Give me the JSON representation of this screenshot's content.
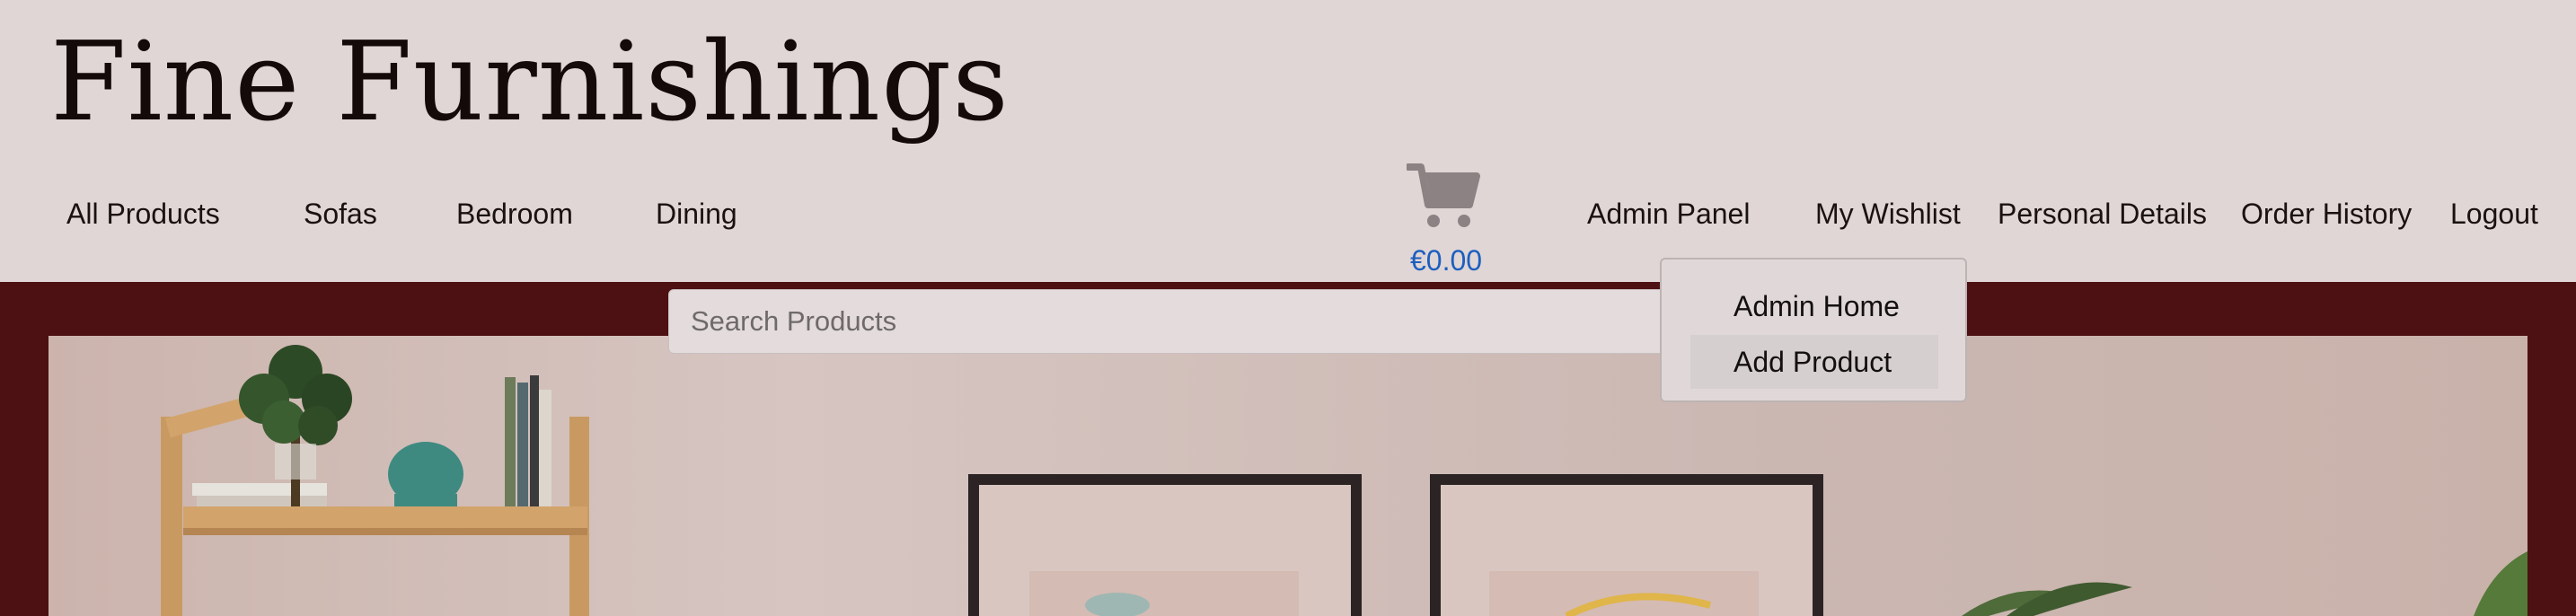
{
  "brand": {
    "title": "Fine Furnishings"
  },
  "nav": {
    "left": [
      {
        "label": "All Products"
      },
      {
        "label": "Sofas"
      },
      {
        "label": "Bedroom"
      },
      {
        "label": "Dining"
      }
    ],
    "right": [
      {
        "label": "Admin Panel"
      },
      {
        "label": "My Wishlist"
      },
      {
        "label": "Personal Details"
      },
      {
        "label": "Order History"
      },
      {
        "label": "Logout"
      }
    ]
  },
  "cart": {
    "icon": "shopping-cart-icon",
    "total": "€0.00"
  },
  "search": {
    "placeholder": "Search Products"
  },
  "admin_menu": {
    "items": [
      {
        "label": "Admin Home"
      },
      {
        "label": "Add Product",
        "hovered": true
      }
    ]
  },
  "colors": {
    "header_bg": "#e0d6d6",
    "page_bg": "#4d1113",
    "price": "#1d5fbf",
    "cart_icon": "#8c8283"
  }
}
